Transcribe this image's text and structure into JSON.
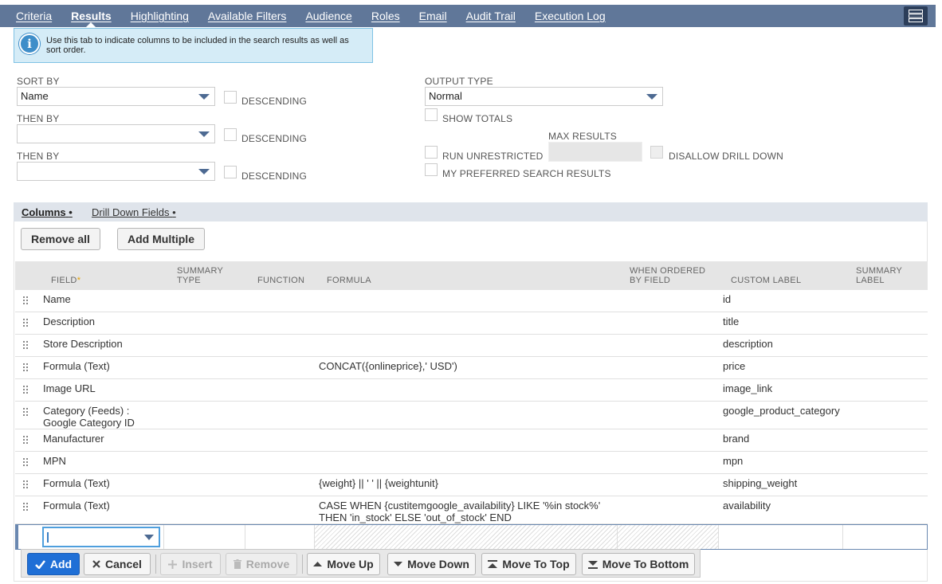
{
  "tabs": [
    {
      "label": "Criteria",
      "active": false
    },
    {
      "label": "Results",
      "active": true
    },
    {
      "label": "Highlighting",
      "active": false
    },
    {
      "label": "Available Filters",
      "active": false
    },
    {
      "label": "Audience",
      "active": false
    },
    {
      "label": "Roles",
      "active": false
    },
    {
      "label": "Email",
      "active": false
    },
    {
      "label": "Audit Trail",
      "active": false
    },
    {
      "label": "Execution Log",
      "active": false
    }
  ],
  "info": {
    "text": "Use this tab to indicate columns to be included in the search results as well as sort order."
  },
  "sort": {
    "sort_by_label": "SORT BY",
    "sort_by_value": "Name",
    "then_by_label_1": "THEN BY",
    "then_by_value_1": "",
    "then_by_label_2": "THEN BY",
    "then_by_value_2": "",
    "descending_label": "DESCENDING"
  },
  "output": {
    "output_type_label": "OUTPUT TYPE",
    "output_type_value": "Normal",
    "show_totals_label": "SHOW TOTALS",
    "max_results_label": "MAX RESULTS",
    "run_unrestricted_label": "RUN UNRESTRICTED",
    "disallow_drill_down_label": "DISALLOW DRILL DOWN",
    "my_preferred_label": "MY PREFERRED SEARCH RESULTS"
  },
  "subtabs": {
    "columns": "Columns",
    "drill_down": "Drill Down Fields",
    "dot": "•"
  },
  "buttons": {
    "remove_all": "Remove all",
    "add_multiple": "Add Multiple"
  },
  "table": {
    "headers": {
      "field": "FIELD",
      "required": "*",
      "summary_type_1": "SUMMARY",
      "summary_type_2": "TYPE",
      "function": "FUNCTION",
      "formula": "FORMULA",
      "when_ordered_1": "WHEN ORDERED",
      "when_ordered_2": "BY FIELD",
      "custom_label": "CUSTOM LABEL",
      "summary_label_1": "SUMMARY",
      "summary_label_2": "LABEL"
    },
    "rows": [
      {
        "field": "Name",
        "formula": "",
        "custom_label": "id"
      },
      {
        "field": "Description",
        "formula": "",
        "custom_label": "title"
      },
      {
        "field": "Store Description",
        "formula": "",
        "custom_label": "description"
      },
      {
        "field": "Formula (Text)",
        "formula": "CONCAT({onlineprice},' USD')",
        "custom_label": "price"
      },
      {
        "field": "Image URL",
        "formula": "",
        "custom_label": "image_link"
      },
      {
        "field": "Category (Feeds) :",
        "field2": "Google Category ID",
        "formula": "",
        "custom_label": "google_product_category"
      },
      {
        "field": "Manufacturer",
        "formula": "",
        "custom_label": "brand"
      },
      {
        "field": "MPN",
        "formula": "",
        "custom_label": "mpn"
      },
      {
        "field": "Formula (Text)",
        "formula": "{weight} || ' ' || {weightunit}",
        "custom_label": "shipping_weight"
      },
      {
        "field": "Formula (Text)",
        "formula": "CASE WHEN {custitemgoogle_availability} LIKE '%in stock%'",
        "formula2": "THEN 'in_stock' ELSE 'out_of_stock' END",
        "custom_label": "availability"
      }
    ]
  },
  "actions": {
    "add": "Add",
    "cancel": "Cancel",
    "insert": "Insert",
    "remove": "Remove",
    "move_up": "Move Up",
    "move_down": "Move Down",
    "move_to_top": "Move To Top",
    "move_to_bottom": "Move To Bottom"
  },
  "colors": {
    "tabbar": "#607799",
    "primary": "#1f6fd6",
    "info_bg": "#d5ecf7"
  }
}
